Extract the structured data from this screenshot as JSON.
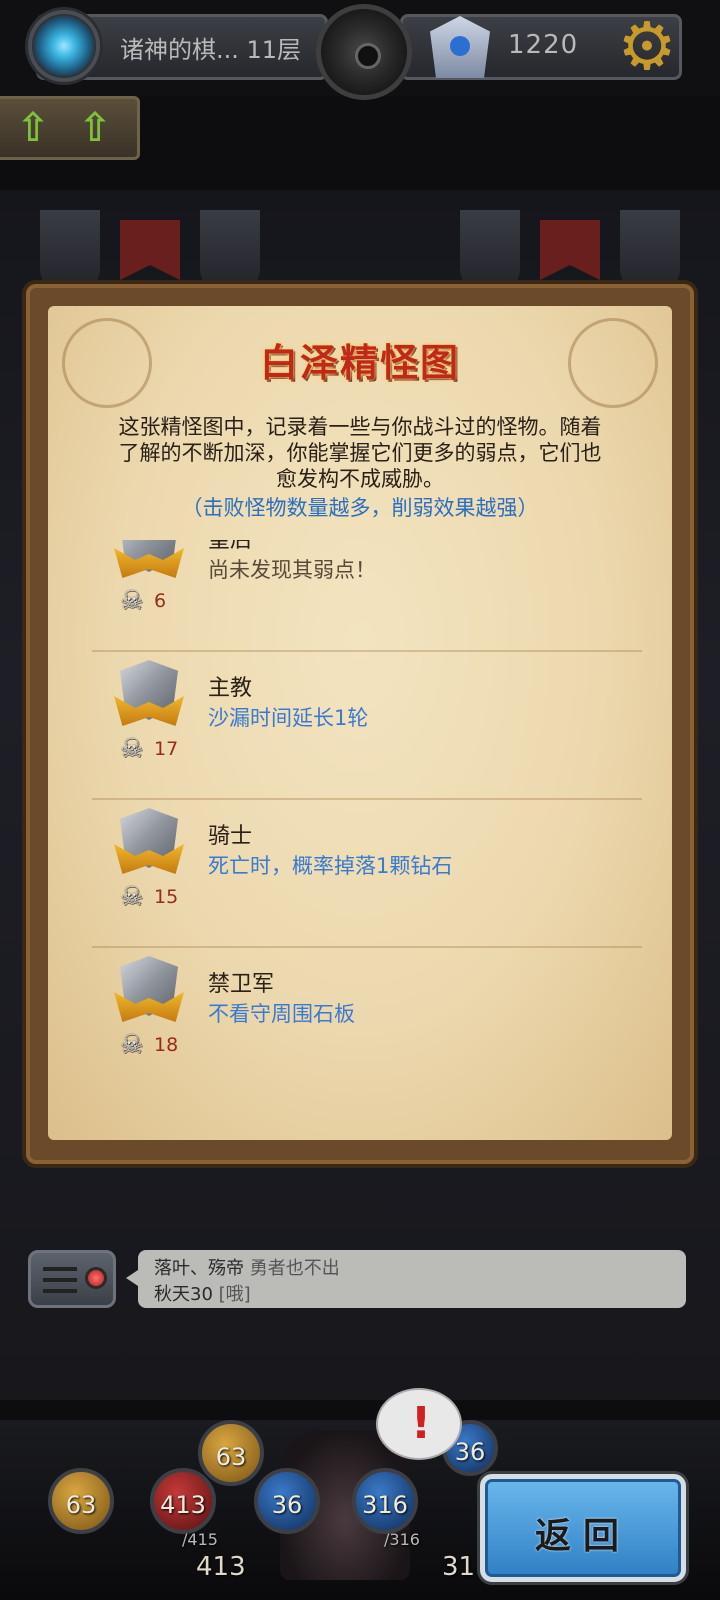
{
  "header": {
    "floor_name": "诸神的棋... 11层",
    "score": "1220"
  },
  "panel": {
    "title": "白泽精怪图",
    "description": "这张精怪图中，记录着一些与你战斗过的怪物。随着了解的不断加深，你能掌握它们更多的弱点，它们也愈发构不成威胁。",
    "hint": "（击败怪物数量越多，削弱效果越强）",
    "monsters": [
      {
        "name": "皇后",
        "effect": "尚未发现其弱点！",
        "kills": "6"
      },
      {
        "name": "主教",
        "effect": "沙漏时间延长1轮",
        "kills": "17"
      },
      {
        "name": "骑士",
        "effect": "死亡时，概率掉落1颗钻石",
        "kills": "15"
      },
      {
        "name": "禁卫军",
        "effect": "不看守周围石板",
        "kills": "18"
      }
    ]
  },
  "chat": {
    "line1_name": "落叶、殇帝",
    "line1_msg": "勇者也不出",
    "line2_name": "秋天30",
    "line2_msg": "[哦]"
  },
  "hud": {
    "orb_gold": "63",
    "orb_gold_top": "63",
    "orb_hp": "413",
    "orb_hp_max": "/415",
    "orb_hp_bottom": "413",
    "orb_mp": "36",
    "orb_shield": "316",
    "orb_shield_max": "/316",
    "orb_right_top": "36",
    "orb_right_bottom": "31"
  },
  "buttons": {
    "return_label": "返回"
  },
  "icons": {
    "settings": "gear-icon",
    "portal": "portal-icon",
    "helmet": "helmet-icon",
    "skull": "skull-icon",
    "chat": "chat-icon",
    "alert": "alert-icon"
  },
  "colors": {
    "title": "#c0281a",
    "hint": "#2b6fc0",
    "effect": "#3a7ad0",
    "kill_count": "#9a2a1a",
    "return_button": "#4a9bdc"
  }
}
